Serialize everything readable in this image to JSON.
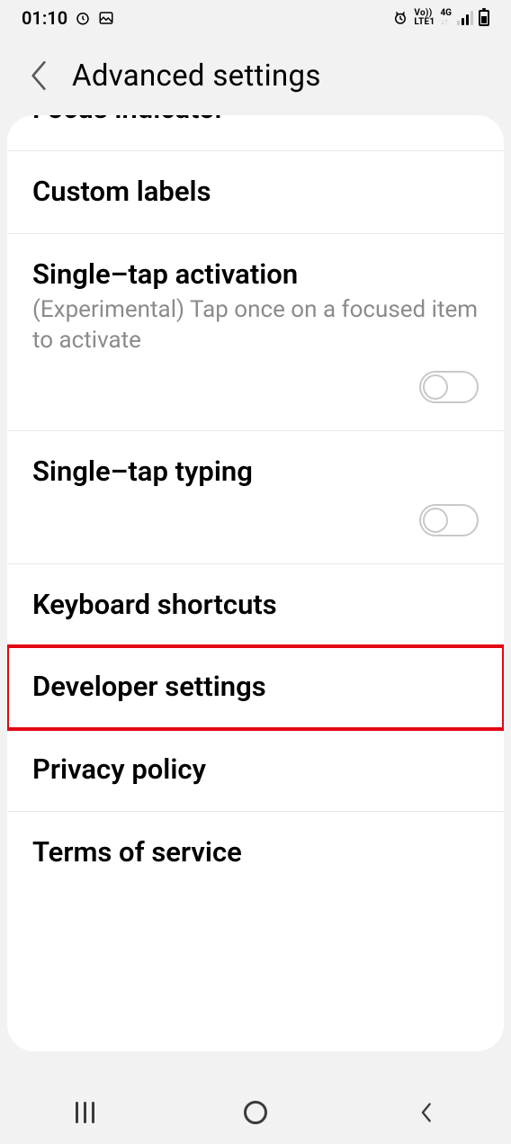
{
  "status": {
    "time": "01:10",
    "net_top": "Vo))",
    "net_bottom": "LTE1",
    "data_top": "4G"
  },
  "header": {
    "title": "Advanced settings"
  },
  "rows": {
    "focus_indicator": "Focus indicator",
    "custom_labels": "Custom labels",
    "single_tap_activation": {
      "title": "Single–tap activation",
      "subtitle": "(Experimental) Tap once on a focused item to activate"
    },
    "single_tap_typing": "Single–tap typing",
    "keyboard_shortcuts": "Keyboard shortcuts",
    "developer_settings": "Developer settings",
    "privacy_policy": "Privacy policy",
    "terms_of_service": "Terms of service"
  }
}
